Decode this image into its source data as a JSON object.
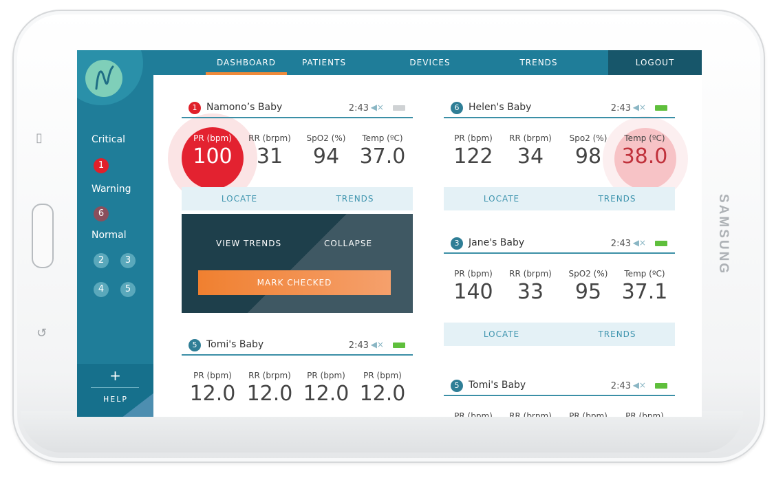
{
  "device": {
    "brand": "SAMSUNG"
  },
  "nav": {
    "items": [
      "DASHBOARD",
      "PATIENTS",
      "DEVICES",
      "TRENDS"
    ],
    "logout": "LOGOUT",
    "active": "DASHBOARD"
  },
  "sidebar": {
    "critical_label": "Critical",
    "critical": [
      "1"
    ],
    "warning_label": "Warning",
    "warning": [
      "6"
    ],
    "normal_label": "Normal",
    "normal": [
      "2",
      "3",
      "4",
      "5"
    ],
    "add": "+",
    "help": "HELP"
  },
  "cards": {
    "namono": {
      "badge": "1",
      "name": "Namono’s Baby",
      "time": "2:43",
      "labels": [
        "PR (bpm)",
        "RR (brpm)",
        "SpO2 (%)",
        "Temp (ºC)"
      ],
      "values": [
        "100",
        "31",
        "94",
        "37.0"
      ],
      "locate": "LOCATE",
      "trends": "TRENDS"
    },
    "helen": {
      "badge": "6",
      "name": "Helen's Baby",
      "time": "2:43",
      "labels": [
        "PR (bpm)",
        "RR (brpm)",
        "Spo2 (%)",
        "Temp (ºC)"
      ],
      "values": [
        "122",
        "34",
        "98",
        "38.0"
      ],
      "locate": "LOCATE",
      "trends": "TRENDS"
    },
    "jane": {
      "badge": "3",
      "name": "Jane's Baby",
      "time": "2:43",
      "labels": [
        "PR (bpm)",
        "RR (brpm)",
        "SpO2 (%)",
        "Temp (ºC)"
      ],
      "values": [
        "140",
        "33",
        "95",
        "37.1"
      ],
      "locate": "LOCATE",
      "trends": "TRENDS"
    },
    "tomi": {
      "badge": "5",
      "name": "Tomi's Baby",
      "time": "2:43",
      "labels": [
        "PR (bpm)",
        "RR (brpm)",
        "PR (bpm)",
        "PR (bpm)"
      ],
      "values": [
        "12.0",
        "12.0",
        "12.0",
        "12.0"
      ]
    },
    "tomi2": {
      "badge": "5",
      "name": "Tomi's Baby",
      "time": "2:43",
      "labels": [
        "PR (bpm)",
        "RR (brpm)",
        "PR (bpm)",
        "PR (bpm)"
      ]
    }
  },
  "expanded": {
    "view_trends": "VIEW TRENDS",
    "collapse": "COLLAPSE",
    "mark_checked": "MARK CHECKED"
  },
  "colors": {
    "nav": "#1f7d99",
    "logout": "#17566a",
    "critical": "#e0202a",
    "warning": "#8a4f5c",
    "accent": "#f08a3a"
  },
  "icons": {
    "mute": "speaker-muted-icon",
    "battery": "battery-icon"
  }
}
